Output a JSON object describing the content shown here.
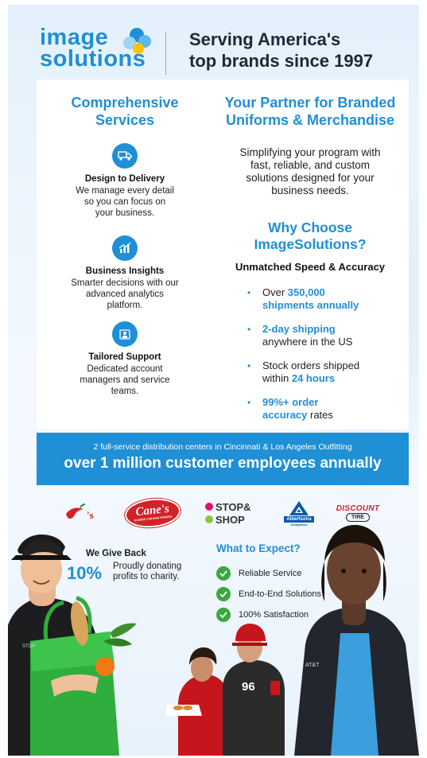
{
  "header": {
    "logo_line1": "image",
    "logo_line2": "solutions",
    "tagline_line1": "Serving America's",
    "tagline_line2": "top brands since 1997"
  },
  "left": {
    "title_line1": "Comprehensive",
    "title_line2": "Services",
    "services": [
      {
        "icon": "truck-icon",
        "title": "Design to Delivery",
        "desc": [
          "We manage every detail",
          "so you can focus on",
          "your business."
        ]
      },
      {
        "icon": "analytics-icon",
        "title": "Business Insights",
        "desc": [
          "Smarter decisions with our",
          "advanced analytics",
          "platform."
        ]
      },
      {
        "icon": "support-icon",
        "title": "Tailored Support",
        "desc": [
          "Dedicated account",
          "managers and service",
          "teams."
        ]
      }
    ]
  },
  "right": {
    "title_line1": "Your Partner for Branded",
    "title_line2": "Uniforms & Merchandise",
    "intro": [
      "Simplifying your program with",
      "fast, reliable, and custom",
      "solutions designed for your",
      "business needs."
    ],
    "why_line1": "Why Choose",
    "why_line2": "ImageSolutions?",
    "subhead": "Unmatched Speed & Accuracy",
    "bullets": [
      {
        "pre": "Over ",
        "hl": "350,000",
        "post": "",
        "line2_hl": "shipments annually",
        "line2_post": ""
      },
      {
        "pre": "",
        "hl": "2-day shipping",
        "post": "",
        "line2_hl": "",
        "line2_post": "anywhere in the US"
      },
      {
        "pre": "Stock orders shipped",
        "hl": "",
        "post": "",
        "line2_hl": "",
        "line2_pre": "within ",
        "line2_hl2": "24 hours"
      },
      {
        "pre": "",
        "hl": "99%+ order",
        "post": "",
        "line2_hl": "accuracy",
        "line2_post": " rates"
      }
    ]
  },
  "band": {
    "small": "2 full-service distribution centers in Cincinnati & Los Angeles Outfitting",
    "big": "over 1 million customer employees annually"
  },
  "brands": {
    "canes": "Cane's",
    "canes_sub": "RAISING CHICKEN FINGERS",
    "stop1": "STOP&",
    "stop2": "SHOP",
    "albertsons": "Albertsons",
    "albertsons_sub": "Companies",
    "discount1": "DISCOUNT",
    "discount2": "TIRE"
  },
  "giveback": {
    "title": "We Give Back",
    "percent": "10%",
    "text_line1": "Proudly donating",
    "text_line2": "profits to charity."
  },
  "expect": {
    "title": "What to Expect?",
    "items": [
      "Reliable Service",
      "End-to-End Solutions",
      "100% Satisfaction"
    ]
  },
  "photo_text": {
    "bag_text": "STOP",
    "shirt_number": "96",
    "jacket_text": "AT&T"
  },
  "colors": {
    "accent": "#1f8fd6",
    "check": "#3aa83f",
    "heading": "#1c2a36"
  }
}
